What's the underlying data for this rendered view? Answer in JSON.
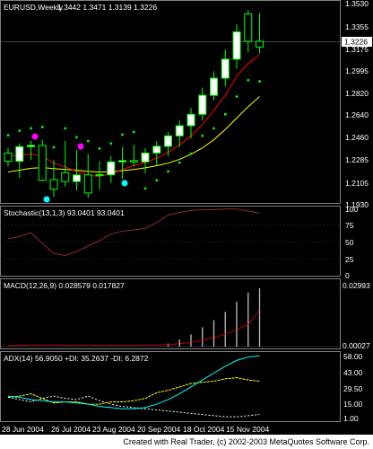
{
  "title": {
    "symbol": "EURUSD,Weekly",
    "ohlc": "1.3442 1.3471 1.3139 1.3226"
  },
  "colors": {
    "background": "#000000",
    "grid": "#808080",
    "bull_candle": "#ffffff",
    "bear_candle": "#000000",
    "candle_border": "#00ff00",
    "ma_fast": "#ff0000",
    "ma_slow": "#ffff00",
    "sar": "#00ff00",
    "stoch_main": "#8b2a2a",
    "macd_hist": "#c0c0c0",
    "macd_signal": "#ff0000",
    "adx": "#00ffff",
    "plus_di": "#ffff00",
    "minus_di": "#ffffff",
    "fractal_up": "#ff00ff",
    "fractal_down": "#00ffff"
  },
  "price_panel": {
    "ticks": [
      "1.3530",
      "1.3355",
      "1.3226",
      "1.3175",
      "1.2995",
      "1.2820",
      "1.2640",
      "1.2460",
      "1.2285",
      "1.2105",
      "1.1930"
    ],
    "current_price": "1.3226",
    "ylim": [
      1.193,
      1.353
    ]
  },
  "stoch_panel": {
    "label": "Stochastic(13,1,3) 93.0401 93.0401",
    "ticks": [
      "100",
      "75",
      "50",
      "25",
      "0"
    ]
  },
  "macd_panel": {
    "label": "MACD(12,26,9) 0.028579 0.017827",
    "ticks": [
      "0.02993",
      "0.00027"
    ]
  },
  "adx_panel": {
    "label": "ADX(14) 56.9050 +DI: 35.2637 -DI: 6.2872",
    "ticks": [
      "58.00",
      "43.00",
      "29.50",
      "15.00",
      "1.00"
    ]
  },
  "x_axis": {
    "ticks": [
      "28 Jun 2004",
      "26 Jul 2004",
      "23 Aug 2004",
      "20 Sep 2004",
      "18 Oct 2004",
      "15 Nov 2004"
    ]
  },
  "credit": "Created with Real Trader, (c) 2002-2003 MetaQuotes Software Corp.",
  "chart_data": {
    "type": "candlestick",
    "title": "EURUSD,Weekly",
    "x": [
      "28 Jun 2004",
      "",
      "",
      "",
      "26 Jul 2004",
      "",
      "",
      "",
      "23 Aug 2004",
      "",
      "",
      "",
      "20 Sep 2004",
      "",
      "",
      "",
      "18 Oct 2004",
      "",
      "",
      "",
      "15 Nov 2004",
      "",
      ""
    ],
    "open": [
      1.2345,
      1.228,
      1.2395,
      1.2405,
      1.2135,
      1.219,
      1.212,
      1.2172,
      1.2175,
      1.2173,
      1.2275,
      1.2285,
      1.2275,
      1.2345,
      1.2398,
      1.248,
      1.256,
      1.265,
      1.28,
      1.2935,
      1.3085,
      1.3442,
      1.3226
    ],
    "high": [
      1.2385,
      1.242,
      1.244,
      1.245,
      1.229,
      1.244,
      1.237,
      1.234,
      1.228,
      1.232,
      1.239,
      1.241,
      1.2385,
      1.244,
      1.251,
      1.26,
      1.27,
      1.286,
      1.299,
      1.316,
      1.336,
      1.3471,
      1.345
    ],
    "low": [
      1.224,
      1.215,
      1.229,
      1.212,
      1.2,
      1.208,
      1.205,
      1.199,
      1.2055,
      1.211,
      1.214,
      1.224,
      1.2185,
      1.225,
      1.232,
      1.239,
      1.246,
      1.26,
      1.276,
      1.287,
      1.301,
      1.3139,
      1.313
    ],
    "close": [
      1.228,
      1.2395,
      1.2405,
      1.213,
      1.206,
      1.212,
      1.2172,
      1.203,
      1.2173,
      1.2275,
      1.2285,
      1.2275,
      1.2345,
      1.2398,
      1.248,
      1.256,
      1.265,
      1.28,
      1.2935,
      1.3085,
      1.33,
      1.3226,
      1.318
    ],
    "ma_fast": [
      1.233,
      1.232,
      1.234,
      1.232,
      1.2265,
      1.2235,
      1.22,
      1.217,
      1.216,
      1.218,
      1.2215,
      1.2245,
      1.227,
      1.2305,
      1.235,
      1.241,
      1.248,
      1.257,
      1.268,
      1.28,
      1.295,
      1.305,
      1.312
    ],
    "ma_slow": [
      1.2195,
      1.221,
      1.2225,
      1.223,
      1.2222,
      1.2215,
      1.221,
      1.22,
      1.2195,
      1.2198,
      1.2205,
      1.2215,
      1.2228,
      1.2245,
      1.2265,
      1.2295,
      1.2335,
      1.2385,
      1.245,
      1.253,
      1.262,
      1.271,
      1.279
    ],
    "stoch": [
      55,
      58,
      64,
      48,
      33,
      30,
      36,
      44,
      52,
      62,
      66,
      68,
      70,
      79,
      90,
      94,
      97,
      98,
      98,
      99,
      99,
      96,
      93
    ],
    "macd_hist": [
      0.0,
      0.0,
      0.0,
      0.0,
      0.0,
      0.0,
      0.0,
      0.0,
      0.0,
      0.0,
      0.0,
      0.0,
      0.0,
      0.0,
      0.0015,
      0.0035,
      0.006,
      0.0095,
      0.013,
      0.017,
      0.022,
      0.0265,
      0.0286
    ],
    "macd_signal": [
      0.0005,
      0.0006,
      0.0007,
      0.0008,
      0.0008,
      0.0007,
      0.0007,
      0.0007,
      0.0006,
      0.0006,
      0.0006,
      0.0006,
      0.0007,
      0.0008,
      0.001,
      0.0014,
      0.0021,
      0.0031,
      0.0044,
      0.0061,
      0.0083,
      0.011,
      0.0178
    ],
    "adx": [
      22,
      21,
      19,
      18,
      17,
      17,
      16,
      15,
      13,
      12,
      11,
      11,
      12,
      15,
      19,
      24,
      30,
      36,
      42,
      48,
      53,
      56,
      57
    ],
    "plus_di": [
      21,
      22,
      24,
      20,
      16,
      17,
      17,
      15,
      15,
      17,
      17,
      18,
      20,
      25,
      27,
      30,
      33,
      34,
      35,
      37,
      38,
      36,
      35
    ],
    "minus_di": [
      21,
      19,
      17,
      20,
      22,
      20,
      19,
      22,
      18,
      15,
      13,
      12,
      11,
      10,
      9,
      8,
      7,
      6,
      5,
      4,
      4,
      5,
      6
    ],
    "ylim": [
      1.193,
      1.353
    ]
  }
}
